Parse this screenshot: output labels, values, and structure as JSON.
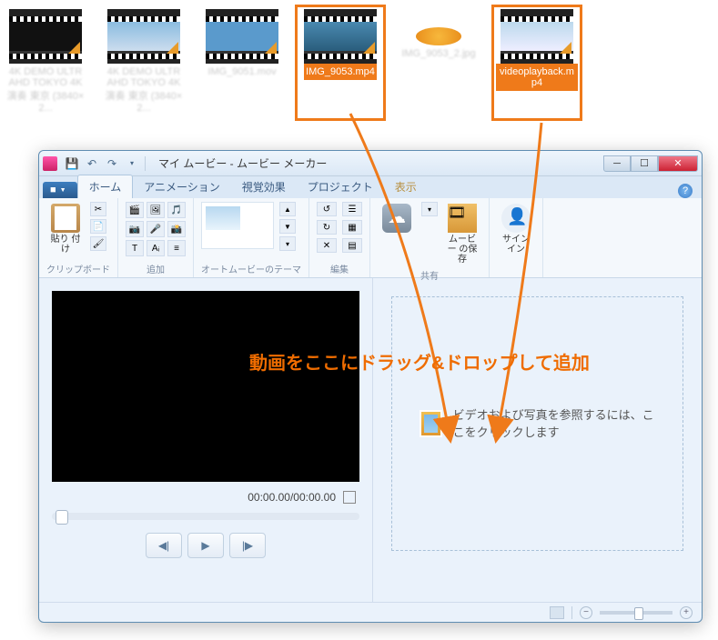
{
  "desktop": {
    "files": [
      {
        "name": "4K DEMO ULTRAHD TOKYO 4K演奏 東京 (3840×2...",
        "blurred": true
      },
      {
        "name": "4K DEMO ULTRAHD TOKYO 4K演奏 東京 (3840×2...",
        "blurred": true
      },
      {
        "name": "IMG_9051.mov",
        "blurred": true
      },
      {
        "name": "IMG_9053.mp4",
        "highlighted": true
      },
      {
        "name": "IMG_9053_2.jpg",
        "blurred": true,
        "is_image": true
      },
      {
        "name": "videoplayback.mp4",
        "highlighted": true
      }
    ]
  },
  "window": {
    "title": "マイ ムービー - ムービー メーカー",
    "tabs": {
      "file": "■▾",
      "home": "ホーム",
      "animation": "アニメーション",
      "visual_effects": "視覚効果",
      "project": "プロジェクト",
      "view": "表示"
    },
    "ribbon": {
      "clipboard": {
        "paste": "貼り\n付け",
        "label": "クリップボード"
      },
      "add": {
        "label": "追加"
      },
      "themes": {
        "label": "オートムービーのテーマ"
      },
      "edit": {
        "label": "編集"
      },
      "share": {
        "label": "共有",
        "save_movie": "ムービー\nの保存"
      },
      "signin": {
        "label": "サインイン"
      }
    },
    "preview": {
      "time": "00:00.00/00:00.00"
    },
    "storyboard": {
      "hint": "ビデオおよび写真を参照するには、ここをクリックします"
    }
  },
  "annotation": {
    "text": "動画をここにドラッグ&ドロップして追加"
  }
}
